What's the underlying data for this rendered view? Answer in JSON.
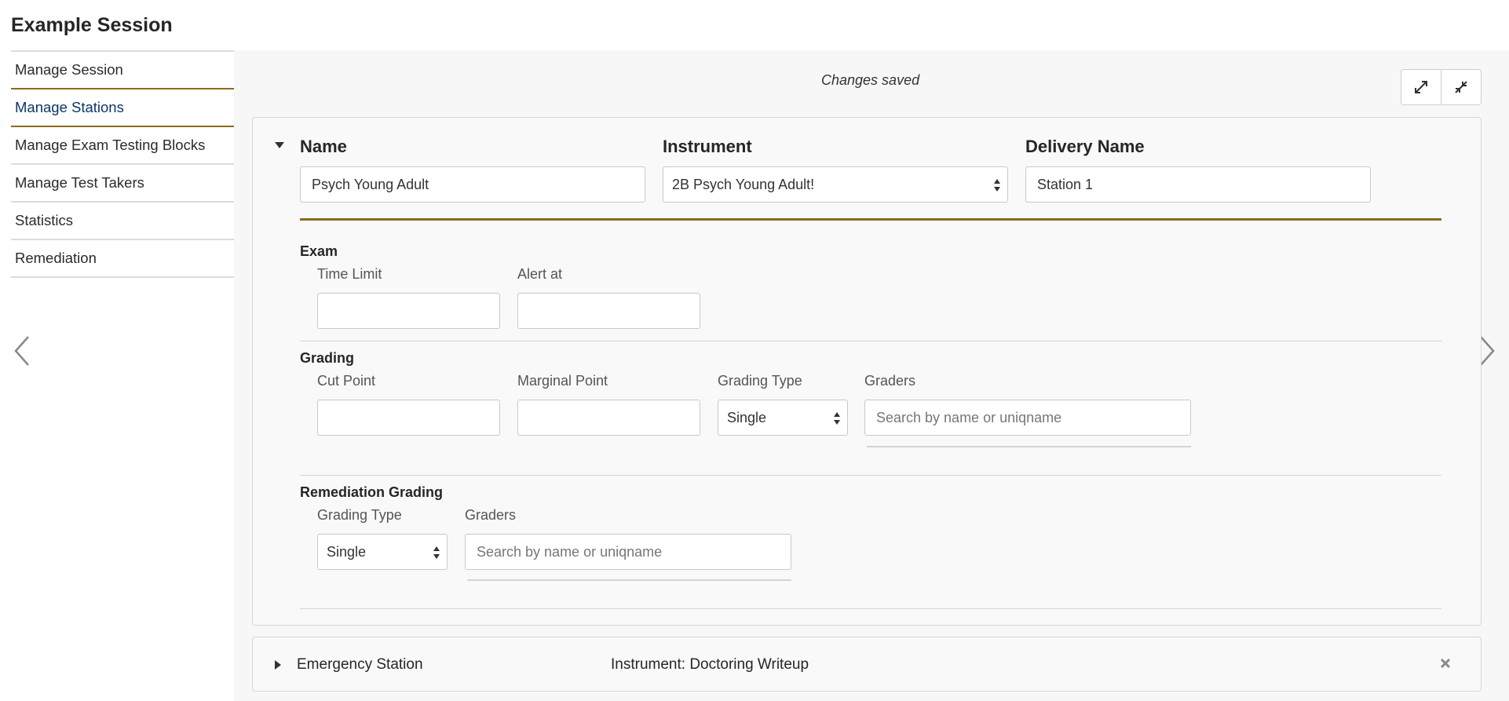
{
  "page": {
    "title": "Example Session",
    "saved_status": "Changes saved"
  },
  "sidebar": {
    "items": [
      {
        "label": "Manage Session",
        "active": false
      },
      {
        "label": "Manage Stations",
        "active": true
      },
      {
        "label": "Manage Exam Testing Blocks",
        "active": false
      },
      {
        "label": "Manage Test Takers",
        "active": false
      },
      {
        "label": "Statistics",
        "active": false
      },
      {
        "label": "Remediation",
        "active": false
      }
    ]
  },
  "toolbar": {
    "expand_icon": "expand-icon",
    "collapse_icon": "collapse-icon"
  },
  "station": {
    "name_label": "Name",
    "name_value": "Psych Young Adult",
    "instrument_label": "Instrument",
    "instrument_value": "2B Psych Young Adult!",
    "delivery_label": "Delivery Name",
    "delivery_value": "Station 1",
    "exam": {
      "section": "Exam",
      "time_limit_label": "Time Limit",
      "time_limit_value": "",
      "alert_label": "Alert at",
      "alert_value": ""
    },
    "grading": {
      "section": "Grading",
      "cut_point_label": "Cut Point",
      "cut_point_value": "",
      "marginal_label": "Marginal Point",
      "marginal_value": "",
      "type_label": "Grading Type",
      "type_value": "Single",
      "graders_label": "Graders",
      "graders_placeholder": "Search by name or uniqname"
    },
    "remediation": {
      "section": "Remediation Grading",
      "type_label": "Grading Type",
      "type_value": "Single",
      "graders_label": "Graders",
      "graders_placeholder": "Search by name or uniqname"
    }
  },
  "station2": {
    "name": "Emergency Station",
    "instrument": "Instrument: Doctoring Writeup"
  },
  "colors": {
    "accent_gold": "#8b6b1c",
    "active_nav": "#0d3566"
  }
}
